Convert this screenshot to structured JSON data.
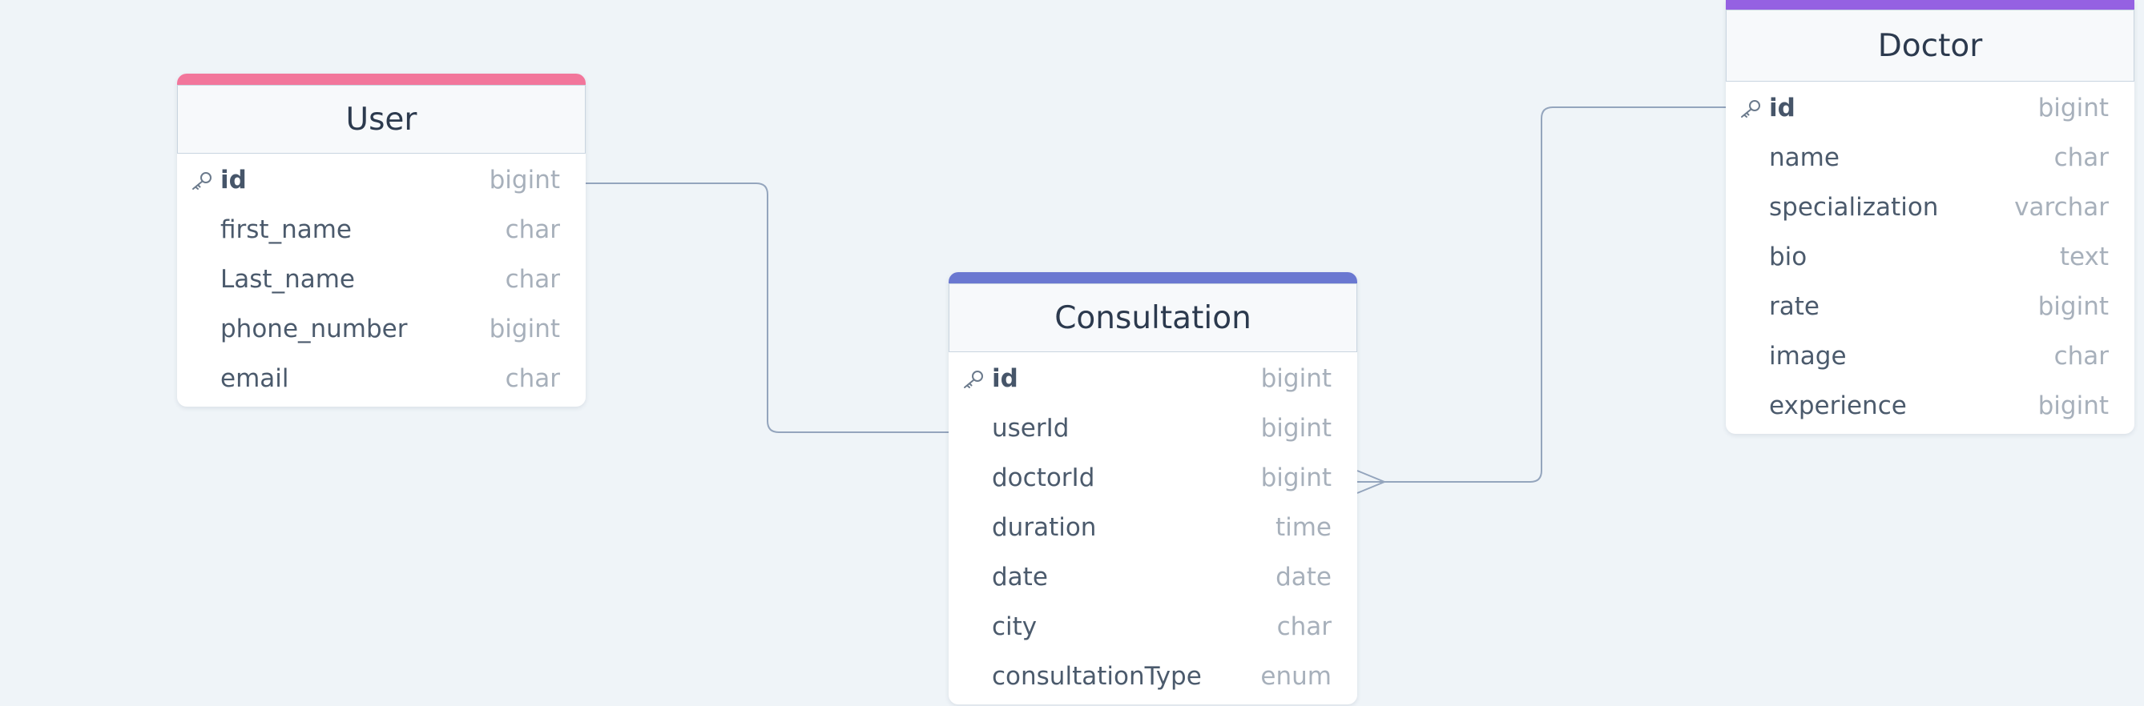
{
  "colors": {
    "background": "#eff4f8",
    "connector": "#94a5bd",
    "user_accent": "#f2769b",
    "consultation_accent": "#6a78d1",
    "doctor_accent": "#9561e2"
  },
  "tables": {
    "user": {
      "title": "User",
      "accent": "#f2769b",
      "fields": [
        {
          "name": "id",
          "type": "bigint",
          "pk": true
        },
        {
          "name": "first_name",
          "type": "char"
        },
        {
          "name": "Last_name",
          "type": "char"
        },
        {
          "name": "phone_number",
          "type": "bigint"
        },
        {
          "name": "email",
          "type": "char"
        }
      ]
    },
    "consultation": {
      "title": "Consultation",
      "accent": "#6a78d1",
      "fields": [
        {
          "name": "id",
          "type": "bigint",
          "pk": true
        },
        {
          "name": "userId",
          "type": "bigint"
        },
        {
          "name": "doctorId",
          "type": "bigint"
        },
        {
          "name": "duration",
          "type": "time"
        },
        {
          "name": "date",
          "type": "date"
        },
        {
          "name": "city",
          "type": "char"
        },
        {
          "name": "consultationType",
          "type": "enum"
        }
      ]
    },
    "doctor": {
      "title": "Doctor",
      "accent": "#9561e2",
      "fields": [
        {
          "name": "id",
          "type": "bigint",
          "pk": true
        },
        {
          "name": "name",
          "type": "char"
        },
        {
          "name": "specialization",
          "type": "varchar"
        },
        {
          "name": "bio",
          "type": "text"
        },
        {
          "name": "rate",
          "type": "bigint"
        },
        {
          "name": "image",
          "type": "char"
        },
        {
          "name": "experience",
          "type": "bigint"
        }
      ]
    }
  },
  "relations": [
    {
      "from": "user.id",
      "to": "consultation.userId",
      "cardinality": "one-to-one"
    },
    {
      "from": "doctor.id",
      "to": "consultation.doctorId",
      "cardinality": "one-to-many"
    }
  ],
  "icons": {
    "primary_key": "key-icon"
  }
}
